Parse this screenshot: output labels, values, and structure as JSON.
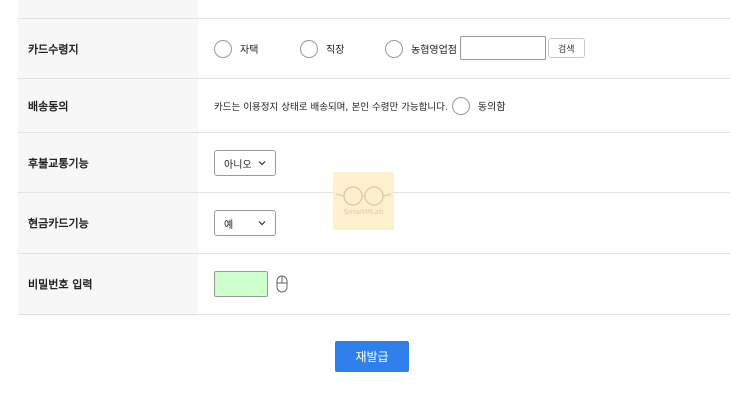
{
  "colors": {
    "accent": "#2f80ed",
    "label_bg": "#f7f7f7",
    "row_border": "#e2e2e2",
    "password_field_bg": "#ccffcc"
  },
  "card_receipt": {
    "label": "카드수령지",
    "options": [
      "자택",
      "직장",
      "농협영업점"
    ],
    "branch_input_value": "",
    "search_button": "검색"
  },
  "delivery_consent": {
    "label": "배송동의",
    "notice": "카드는 이용정지 상태로 배송되며, 본인 수령만 가능합니다.",
    "option": "동의함"
  },
  "transit_function": {
    "label": "후불교통기능",
    "selected": "아니오",
    "icon": "chevron-down-icon"
  },
  "cash_card_function": {
    "label": "현금카드기능",
    "selected": "예",
    "icon": "chevron-down-icon"
  },
  "password": {
    "label": "비밀번호 입력",
    "icon": "mouse-icon"
  },
  "submit_button": "재발급",
  "watermark": "SmartMLab"
}
